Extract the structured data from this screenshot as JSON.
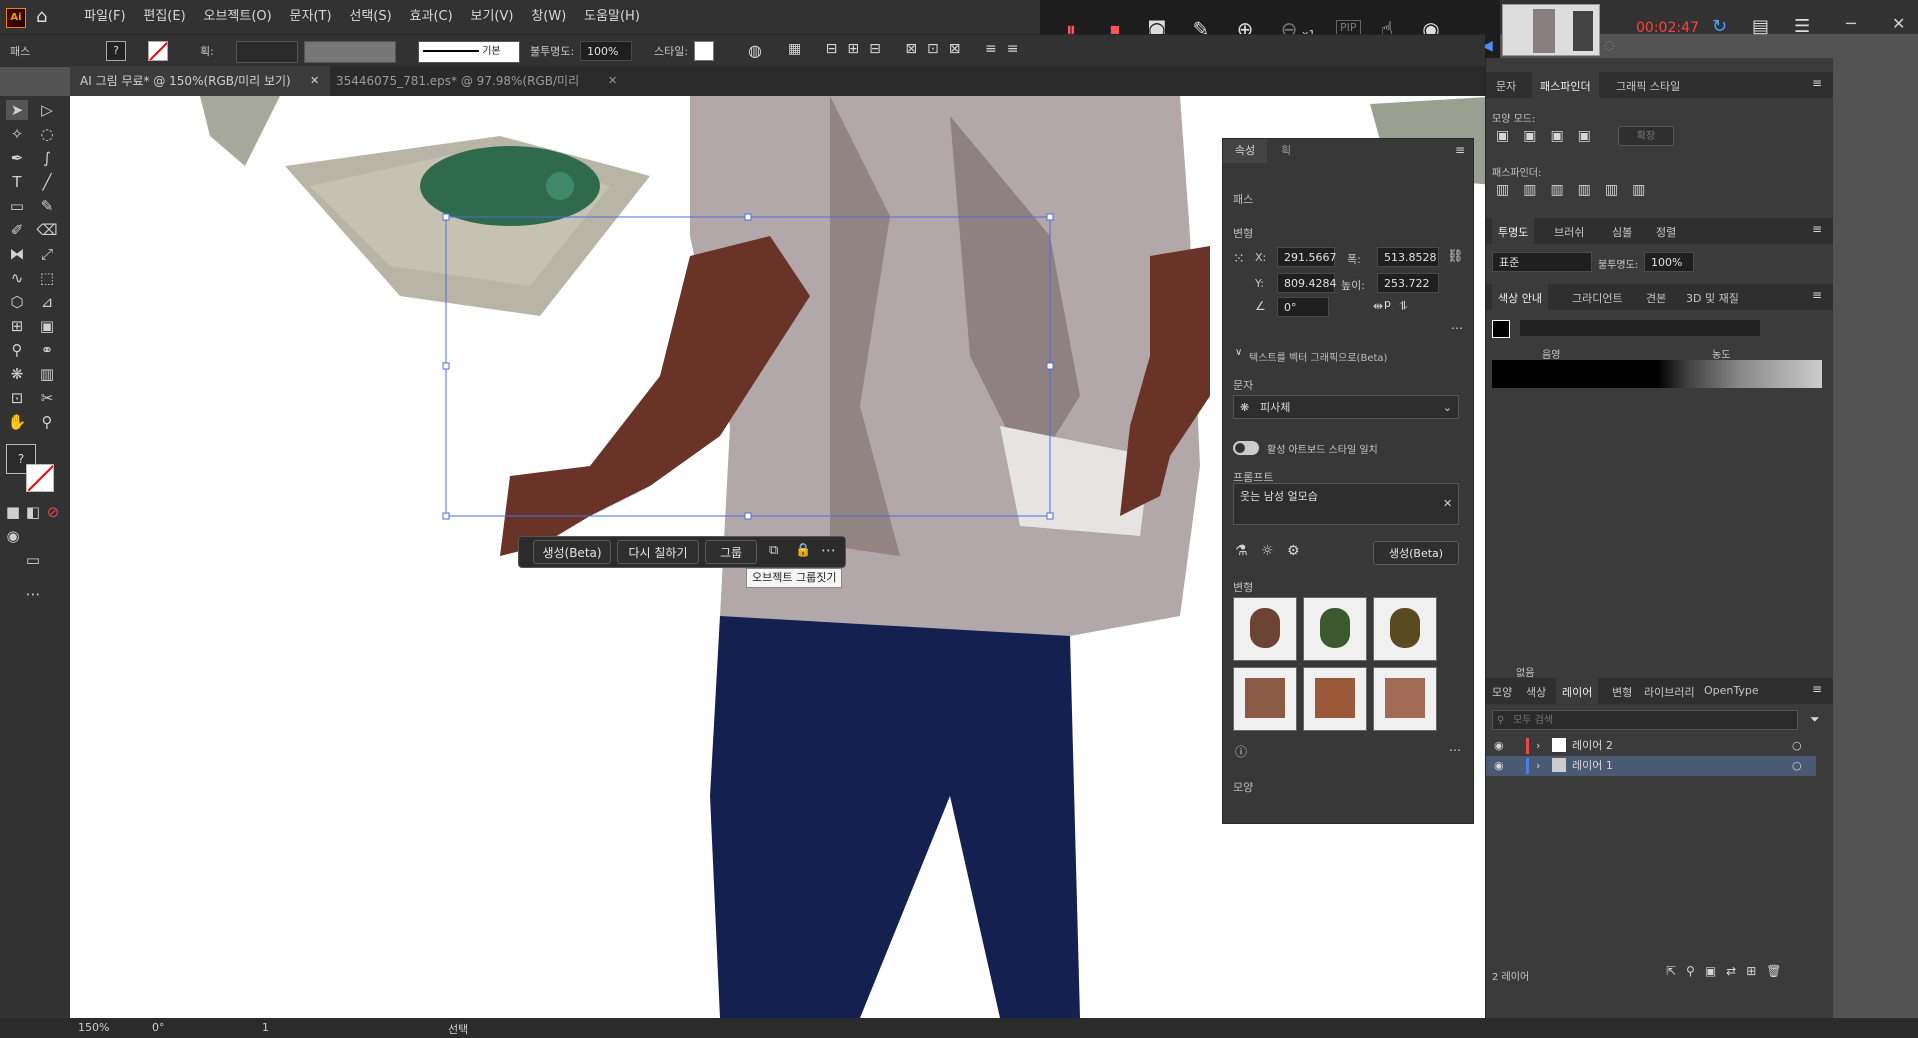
{
  "app": {
    "logo": "Ai"
  },
  "menu": [
    "파일(F)",
    "편집(E)",
    "오브젝트(O)",
    "문자(T)",
    "선택(S)",
    "효과(C)",
    "보기(V)",
    "창(W)",
    "도움말(H)"
  ],
  "control_bar": {
    "object_label": "패스",
    "stroke_label": "획:",
    "stroke_style": "기본",
    "opacity_label": "불투명도:",
    "opacity_value": "100%",
    "style_label": "스타일:"
  },
  "doc_tabs": [
    {
      "label": "AI 그림 무료* @ 150%(RGB/미리 보기)",
      "active": true
    },
    {
      "label": "35446075_781.eps* @ 97.98%(RGB/미리 보기)",
      "active": false
    }
  ],
  "recorder": {
    "timer": "00:02:47",
    "zoom_indicator": "x1",
    "pip": "PIP"
  },
  "context_toolbar": {
    "generate": "생성(Beta)",
    "recolor": "다시 칠하기",
    "group": "그룹",
    "tooltip": "오브젝트 그룹짓기"
  },
  "properties": {
    "tabs": [
      "속성",
      "획"
    ],
    "section_path": "패스",
    "transform_label": "변형",
    "x_label": "X:",
    "x": "291.5667",
    "w_label": "폭:",
    "w": "513.8528",
    "y_label": "Y:",
    "y": "809.4284",
    "h_label": "높이:",
    "h": "253.722 p",
    "angle": "0°",
    "t2v_title": "텍스트를 벡터 그래픽으로(Beta)",
    "type_label": "문자",
    "type_value": "피사체",
    "match_style": "활성 아트보드 스타일 일치",
    "prompt_label": "프롬프트",
    "prompt_value": "웃는 남성 얼모습",
    "generate_button": "생성(Beta)",
    "variations_label": "변형",
    "appearance_label": "모양"
  },
  "right_panels": {
    "tabs_top": [
      "문자",
      "패스파인더",
      "그래픽 스타일"
    ],
    "shape_modes": "모양 모드:",
    "expand": "확장",
    "pathfinder": "패스파인더:",
    "transparency_tabs": [
      "투명도",
      "브러쉬",
      "심볼",
      "정렬"
    ],
    "blend_mode": "표준",
    "opacity_label": "불투명도:",
    "opacity": "100%",
    "color_guide_tabs": [
      "색상 안내",
      "그라디언트",
      "견본",
      "3D 및 재질"
    ],
    "shade_label": "음영",
    "tint_label": "농도",
    "none_label": "없음",
    "layers_tabs": [
      "모양",
      "색상",
      "레이어",
      "변형",
      "라이브러리",
      "OpenType"
    ],
    "search_placeholder": "모두 검색",
    "layers": [
      {
        "name": "레이어 2",
        "color": "#e84a4a",
        "selected": false
      },
      {
        "name": "레이어 1",
        "color": "#4a7ee8",
        "selected": true
      }
    ],
    "layer_count": "2 레이어"
  },
  "status": {
    "zoom": "150%",
    "rotation": "0°",
    "artboard": "1",
    "tool": "선택"
  },
  "colors": {
    "selection": "#4a6fd8",
    "jeans": "#14204f",
    "skin": "#6a3328",
    "shirt": "#b0a6a6"
  }
}
